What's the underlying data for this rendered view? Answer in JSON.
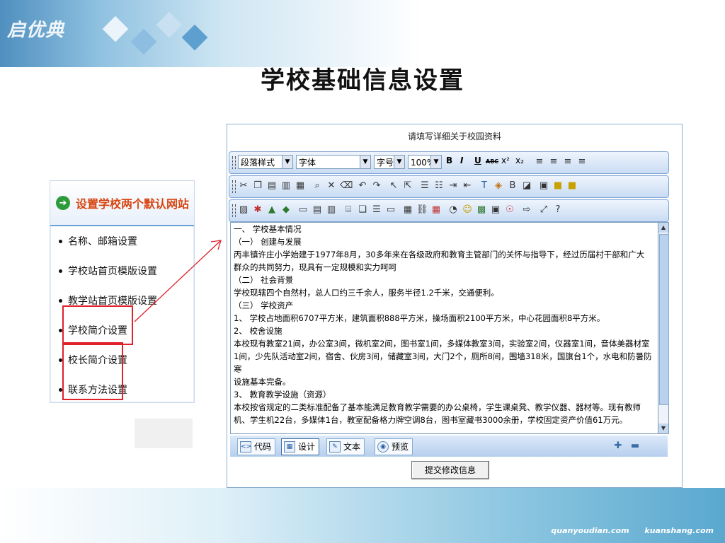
{
  "slide": {
    "title": "学校基础信息设置",
    "logo_text": "启优典",
    "footer_links": [
      "quanyoudian.com",
      "kuanshang.com"
    ]
  },
  "menu": {
    "header": "设置学校两个默认网站",
    "items": [
      {
        "label": "名称、邮箱设置"
      },
      {
        "label": "学校站首页模版设置"
      },
      {
        "label": "教学站首页模版设置"
      },
      {
        "label": "学校简介设置"
      },
      {
        "label": "校长简介设置"
      },
      {
        "label": "联系方法设置"
      }
    ]
  },
  "editor": {
    "heading": "请填写详细关于校园资料",
    "toolbar": {
      "paragraph_style": "段落样式",
      "font": "字体",
      "font_size": "字号",
      "zoom": "100%",
      "bold": "B",
      "italic": "I",
      "underline": "U",
      "strike": "ABC",
      "superscript": "x²",
      "subscript": "x₂"
    },
    "content": [
      "一、  学校基本情况",
      "（一）        创建与发展",
      "    丙丰镇许庄小学始建于1977年8月，30多年来在各级政府和教育主管部门的关怀与指导下，经过历届村干部和广大",
      "群众的共同努力，现具有一定规模和实力呵呵",
      "（二）        社会背景",
      "    学校现辖四个自然村，总人口约三千余人，服务半径1.2千米，交通便利。",
      "（三）        学校资产",
      "1、 学校占地面积6707平方米，建筑面积888平方米，操场面积2100平方米，中心花园面积8平方米。",
      "2、 校舍设施",
      "    本校现有教室21间，办公室3间，微机室2间，图书室1间，多媒体教室3间，实验室2间，仪器室1间，音体美器材室",
      "1间，少先队活动室2间，宿舍、伙房3间，储藏室3间，大门2个，厕所8间，围墙318米，国旗台1个，水电和防暑防寒",
      "设施基本完备。",
      "3、 教育教学设施（资源）",
      "    本校按省规定的二类标准配备了基本能满足教育教学需要的办公桌椅，学生课桌凳、教学仪器、器材等。现有教师",
      "机、学生机22台，多媒体1台，教室配备格力牌空调8台，图书室藏书3000余册，学校固定资产价值61万元。"
    ],
    "modes": {
      "code": "代码",
      "design": "设计",
      "text": "文本",
      "preview": "预览"
    },
    "submit": "提交修改信息"
  }
}
